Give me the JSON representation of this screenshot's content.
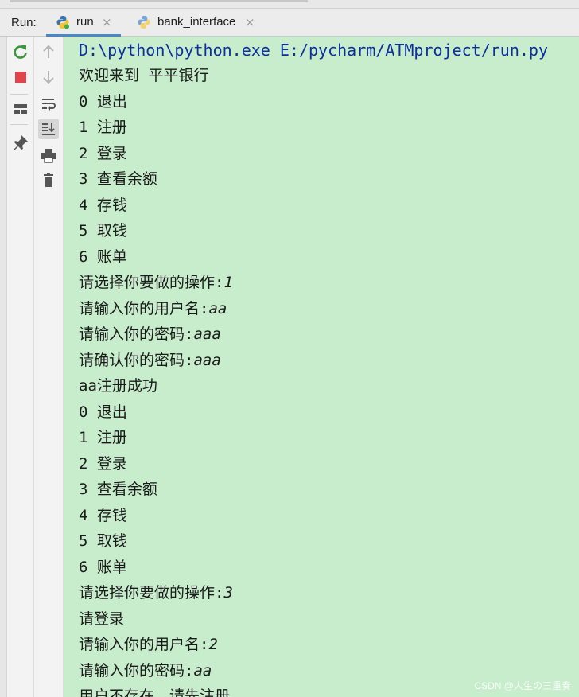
{
  "run_panel": {
    "label": "Run:",
    "tabs": [
      {
        "label": "run",
        "active": true
      },
      {
        "label": "bank_interface",
        "active": false
      }
    ],
    "close_glyph": "×"
  },
  "toolbar": {
    "rerun": "rerun-icon",
    "stop": "stop-icon",
    "layout": "layout-icon",
    "pin": "pin-icon",
    "up": "arrow-up-icon",
    "down": "arrow-down-icon",
    "soft_wrap": "soft-wrap-icon",
    "scroll_to_end": "scroll-to-end-icon",
    "print": "print-icon",
    "clear": "trash-icon"
  },
  "console": {
    "command": "D:\\python\\python.exe E:/pycharm/ATMproject/run.py",
    "lines": [
      {
        "text": "欢迎来到 平平银行",
        "input": ""
      },
      {
        "text": "0 退出",
        "input": ""
      },
      {
        "text": "1 注册",
        "input": ""
      },
      {
        "text": "2 登录",
        "input": ""
      },
      {
        "text": "3 查看余额",
        "input": ""
      },
      {
        "text": "4 存钱",
        "input": ""
      },
      {
        "text": "5 取钱",
        "input": ""
      },
      {
        "text": "6 账单",
        "input": ""
      },
      {
        "text": "请选择你要做的操作:",
        "input": "1"
      },
      {
        "text": "请输入你的用户名:",
        "input": "aa"
      },
      {
        "text": "请输入你的密码:",
        "input": "aaa"
      },
      {
        "text": "请确认你的密码:",
        "input": "aaa"
      },
      {
        "text": "aa注册成功",
        "input": ""
      },
      {
        "text": "0 退出",
        "input": ""
      },
      {
        "text": "1 注册",
        "input": ""
      },
      {
        "text": "2 登录",
        "input": ""
      },
      {
        "text": "3 查看余额",
        "input": ""
      },
      {
        "text": "4 存钱",
        "input": ""
      },
      {
        "text": "5 取钱",
        "input": ""
      },
      {
        "text": "6 账单",
        "input": ""
      },
      {
        "text": "请选择你要做的操作:",
        "input": "3"
      },
      {
        "text": "请登录",
        "input": ""
      },
      {
        "text": "请输入你的用户名:",
        "input": "2"
      },
      {
        "text": "请输入你的密码:",
        "input": "aa"
      },
      {
        "text": "用户不存在，请先注册",
        "input": ""
      }
    ]
  },
  "watermark": "CSDN @人生の三重奏",
  "colors": {
    "console_bg": "#c7edcc",
    "command_text": "#0b2f9e",
    "tab_underline": "#4a86c8"
  }
}
